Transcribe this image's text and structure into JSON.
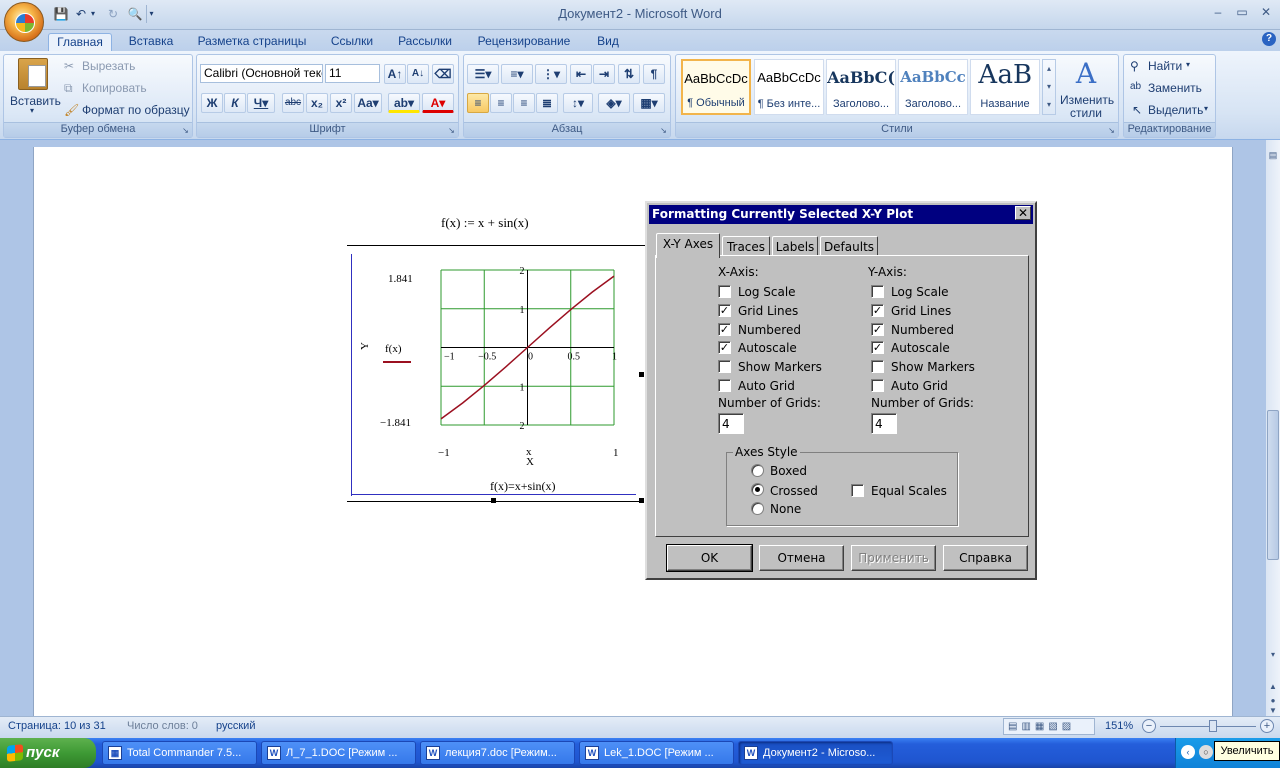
{
  "window": {
    "title": "Документ2 - Microsoft Word"
  },
  "qat": {
    "save_icon": "save-icon",
    "undo_icon": "undo-icon",
    "redo_icon": "redo-icon",
    "preview_icon": "print-preview-icon"
  },
  "tabs": [
    {
      "label": "Главная",
      "active": true
    },
    {
      "label": "Вставка"
    },
    {
      "label": "Разметка страницы"
    },
    {
      "label": "Ссылки"
    },
    {
      "label": "Рассылки"
    },
    {
      "label": "Рецензирование"
    },
    {
      "label": "Вид"
    }
  ],
  "ribbon": {
    "clipboard": {
      "label": "Буфер обмена",
      "paste": "Вставить",
      "cut": "Вырезать",
      "copy": "Копировать",
      "format_painter": "Формат по образцу"
    },
    "font": {
      "label": "Шрифт",
      "font_name": "Calibri (Основной текст)",
      "font_size": "11"
    },
    "paragraph": {
      "label": "Абзац"
    },
    "styles": {
      "label": "Стили",
      "items": [
        {
          "preview": "AaBbCcDc",
          "name": "¶ Обычный"
        },
        {
          "preview": "AaBbCcDc",
          "name": "¶ Без инте..."
        },
        {
          "preview": "AaBbC(",
          "name": "Заголово..."
        },
        {
          "preview": "AaBbCc",
          "name": "Заголово..."
        },
        {
          "preview": "АаВ",
          "name": "Название"
        }
      ],
      "change": "Изменить стили"
    },
    "editing": {
      "label": "Редактирование",
      "find": "Найти",
      "replace": "Заменить",
      "select": "Выделить"
    }
  },
  "document": {
    "definition": "f(x) := x + sin(x)",
    "plot": {
      "ymax_label": "1.841",
      "ymin_label": "−1.841",
      "ylabel": "Y",
      "legend": "f(x)",
      "xmin_label": "−1",
      "xmax_label": "1",
      "xlabel_small": "x",
      "xlabel": "X",
      "caption": "f(x)=x+sin(x)",
      "inner_x_ticks": [
        "−1",
        "−0.5",
        "0",
        "0.5",
        "1"
      ],
      "inner_y_ticks": [
        "2",
        "1",
        "1",
        "2"
      ],
      "line_color": "#9b1020",
      "grid_color": "#2e9a2e"
    }
  },
  "chart_data": {
    "type": "line",
    "title": "",
    "x": [
      -1,
      -0.75,
      -0.5,
      -0.25,
      0,
      0.25,
      0.5,
      0.75,
      1
    ],
    "series": [
      {
        "name": "f(x)",
        "values": [
          -1.841,
          -1.432,
          -0.979,
          -0.497,
          0,
          0.497,
          0.979,
          1.432,
          1.841
        ]
      }
    ],
    "xlim": [
      -1,
      1
    ],
    "ylim": [
      -2,
      2
    ],
    "xlabel": "X",
    "ylabel": "Y",
    "grid": true
  },
  "dialog": {
    "title": "Formatting Currently Selected X-Y Plot",
    "tabs": [
      "X-Y Axes",
      "Traces",
      "Labels",
      "Defaults"
    ],
    "x_axis": {
      "heading": "X-Axis:",
      "options": [
        {
          "label": "Log Scale",
          "checked": false
        },
        {
          "label": "Grid Lines",
          "checked": true
        },
        {
          "label": "Numbered",
          "checked": true
        },
        {
          "label": "Autoscale",
          "checked": true
        },
        {
          "label": "Show Markers",
          "checked": false
        },
        {
          "label": "Auto Grid",
          "checked": false
        }
      ],
      "grids_label": "Number of Grids:",
      "grids_value": "4"
    },
    "y_axis": {
      "heading": "Y-Axis:",
      "options": [
        {
          "label": "Log Scale",
          "checked": false
        },
        {
          "label": "Grid Lines",
          "checked": true
        },
        {
          "label": "Numbered",
          "checked": true
        },
        {
          "label": "Autoscale",
          "checked": true
        },
        {
          "label": "Show Markers",
          "checked": false
        },
        {
          "label": "Auto Grid",
          "checked": false
        }
      ],
      "grids_label": "Number of Grids:",
      "grids_value": "4"
    },
    "axes_style": {
      "label": "Axes Style",
      "boxed": "Boxed",
      "crossed": "Crossed",
      "none": "None",
      "selected": "crossed",
      "equal_scales": "Equal Scales",
      "equal_checked": false
    },
    "buttons": {
      "ok": "OK",
      "cancel": "Отмена",
      "apply": "Применить",
      "help": "Справка"
    }
  },
  "status": {
    "page": "Страница: 10 из 31",
    "words": "Число слов: 0",
    "lang": "русский",
    "zoom": "151%"
  },
  "taskbar": {
    "start": "пуск",
    "tasks": [
      {
        "label": "Total Commander 7.5..."
      },
      {
        "label": "Л_7_1.DOC [Режим ..."
      },
      {
        "label": "лекция7.doc [Режим..."
      },
      {
        "label": "Lek_1.DOC [Режим ..."
      },
      {
        "label": "Документ2 - Microso...",
        "active": true
      }
    ],
    "tooltip": "Увеличить"
  }
}
